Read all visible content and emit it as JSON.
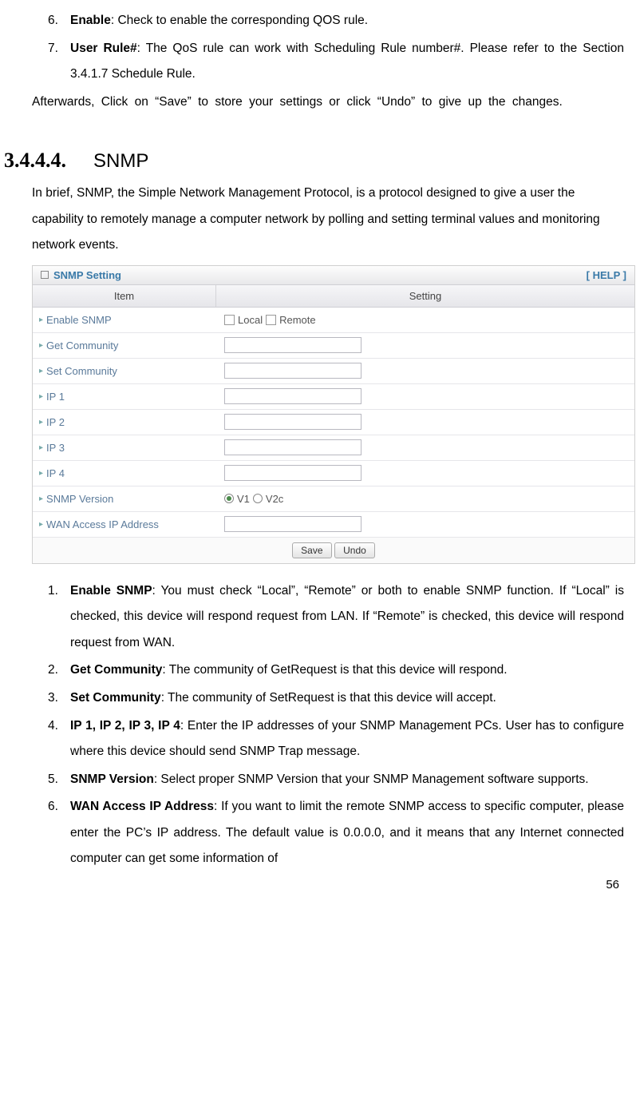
{
  "top_list": [
    {
      "num": "6.",
      "bold": "Enable",
      "text": ": Check to enable the corresponding QOS rule."
    },
    {
      "num": "7.",
      "bold": "User Rule#",
      "text": ": The QoS rule can work with Scheduling Rule number#. Please refer to the Section 3.4.1.7 Schedule Rule."
    }
  ],
  "afterwards": "Afterwards, Click on “Save” to store your settings or click “Undo” to give up the changes.",
  "section": {
    "num": "3.4.4.4.",
    "title": "SNMP"
  },
  "intro": "In brief, SNMP, the Simple Network Management Protocol, is a protocol designed to give a user the capability to remotely manage a computer network by polling and setting terminal values and monitoring network events.",
  "screenshot": {
    "title": "SNMP Setting",
    "help": "[ HELP ]",
    "header_item": "Item",
    "header_setting": "Setting",
    "rows": {
      "enable": "Enable SNMP",
      "local": "Local",
      "remote": "Remote",
      "get": "Get Community",
      "set": "Set Community",
      "ip1": "IP 1",
      "ip2": "IP 2",
      "ip3": "IP 3",
      "ip4": "IP 4",
      "version": "SNMP Version",
      "v1": "V1",
      "v2c": "V2c",
      "wan": "WAN Access IP Address"
    },
    "save": "Save",
    "undo": "Undo"
  },
  "bottom_list": [
    {
      "num": "1.",
      "bold": "Enable SNMP",
      "text": ": You must check “Local”, “Remote” or both to enable SNMP function. If “Local” is checked, this device will respond request from LAN. If “Remote” is checked, this device will respond request from WAN."
    },
    {
      "num": "2.",
      "bold": "Get Community",
      "text": ": The community of GetRequest is that this device will respond."
    },
    {
      "num": "3.",
      "bold": "Set Community",
      "text": ": The community of SetRequest is that this device will accept."
    },
    {
      "num": "4.",
      "bold": "IP 1, IP 2, IP 3, IP 4",
      "text": ": Enter the IP addresses of your SNMP Management PCs. User has to configure where this device should send SNMP Trap message."
    },
    {
      "num": "5.",
      "bold": "SNMP Version",
      "text": ": Select proper SNMP Version that your SNMP Management software supports."
    },
    {
      "num": "6.",
      "bold": "WAN Access IP Address",
      "text": ": If you want to limit the remote SNMP access to specific computer, please enter the PC’s IP address. The default value is 0.0.0.0, and it means that any Internet connected computer can get some information of"
    }
  ],
  "page_number": "56"
}
